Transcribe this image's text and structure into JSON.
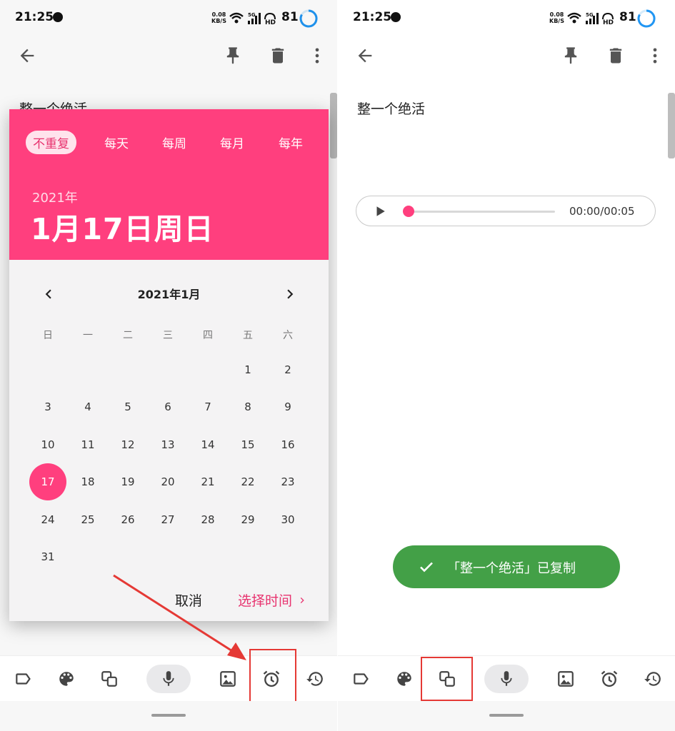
{
  "status_bar": {
    "time": "21:25",
    "net_speed_value": "0.08",
    "net_speed_unit": "KB/S",
    "signal_label": "5G",
    "hd_label": "HD",
    "battery": "81"
  },
  "left": {
    "note_title": "整一个绝活",
    "repeat_options": [
      "不重复",
      "每天",
      "每周",
      "每月",
      "每年"
    ],
    "selected_repeat": "不重复",
    "header_year": "2021年",
    "header_date": "1月17日周日",
    "month_label": "2021年1月",
    "weekdays": [
      "日",
      "一",
      "二",
      "三",
      "四",
      "五",
      "六"
    ],
    "days": [
      "1",
      "2",
      "3",
      "4",
      "5",
      "6",
      "7",
      "8",
      "9",
      "10",
      "11",
      "12",
      "13",
      "14",
      "15",
      "16",
      "17",
      "18",
      "19",
      "20",
      "21",
      "22",
      "23",
      "24",
      "25",
      "26",
      "27",
      "28",
      "29",
      "30",
      "31"
    ],
    "first_weekday_index": 5,
    "selected_day": "17",
    "cancel_label": "取消",
    "pick_time_label": "选择时间"
  },
  "right": {
    "note_title": "整一个绝活",
    "audio_time": "00:00/00:05",
    "audio_progress": 0.0,
    "toast_text": "「整一个绝活」已复制"
  },
  "colors": {
    "accent": "#ff3f7e",
    "toast": "#43a047",
    "highlight_box": "#e53935"
  },
  "bottom_icons": [
    "label-icon",
    "palette-icon",
    "copy-icon",
    "mic-icon",
    "image-icon",
    "alarm-icon",
    "history-icon"
  ]
}
